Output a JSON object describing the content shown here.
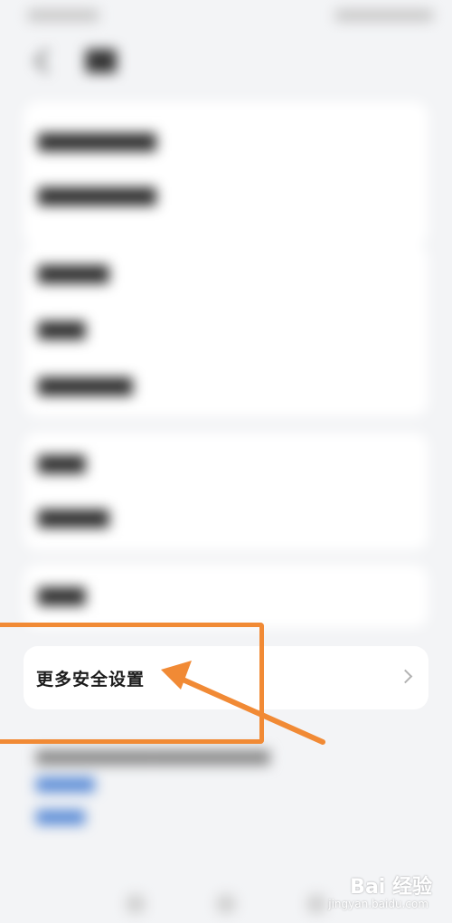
{
  "screen": {
    "more_security_label": "更多安全设置",
    "watermark": {
      "main": "Bai 经验",
      "sub": "jingyan.baidu.com"
    }
  },
  "colors": {
    "highlight": "#f18a35",
    "background": "#f3f4f6",
    "card": "#ffffff"
  },
  "icons": {
    "row_chevron": "chevron-right-icon",
    "annotation_arrow": "arrow-icon"
  }
}
